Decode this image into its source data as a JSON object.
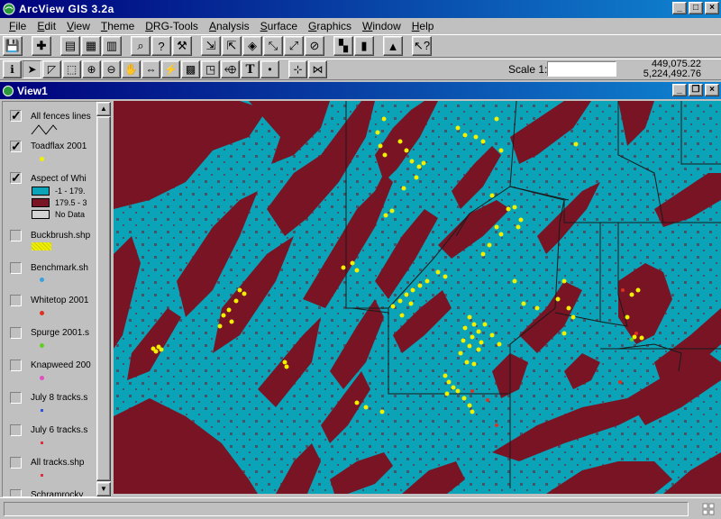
{
  "app": {
    "title": "ArcView GIS 3.2a"
  },
  "menu": [
    "File",
    "Edit",
    "View",
    "Theme",
    "DRG-Tools",
    "Analysis",
    "Surface",
    "Graphics",
    "Window",
    "Help"
  ],
  "scale": {
    "label": "Scale 1:",
    "value": ""
  },
  "coordinates": {
    "x": "449,075.22",
    "y": "5,224,492.76"
  },
  "view": {
    "title": "View1"
  },
  "status": {
    "text": ""
  },
  "colors": {
    "map_water": "#0aa3b8",
    "map_aspect_high": "#781424",
    "points": "#f0f000",
    "titlebar": "#00007b"
  },
  "toc": {
    "layers": [
      {
        "name": "All fences lines",
        "checked": true,
        "symbol": "line"
      },
      {
        "name": "Toadflax 2001",
        "checked": true,
        "symbol": "dot",
        "color": "#f0f000"
      },
      {
        "name": "Aspect of Whi",
        "checked": true,
        "symbol": "legend",
        "legend": [
          {
            "label": "-1 - 179.",
            "color": "#0aa3b8"
          },
          {
            "label": "179.5 - 3",
            "color": "#781424"
          },
          {
            "label": "No Data",
            "color": "#d4d4d4"
          }
        ]
      },
      {
        "name": "Buckbrush.shp",
        "checked": false,
        "symbol": "pattern",
        "color": "#f0f000"
      },
      {
        "name": "Benchmark.sh",
        "checked": false,
        "symbol": "dot",
        "color": "#3aa0e0"
      },
      {
        "name": "Whitetop 2001",
        "checked": false,
        "symbol": "dot",
        "color": "#e03020"
      },
      {
        "name": "Spurge 2001.s",
        "checked": false,
        "symbol": "dot",
        "color": "#60d020"
      },
      {
        "name": "Knapweed 200",
        "checked": false,
        "symbol": "dot",
        "color": "#e050c0"
      },
      {
        "name": "July 8 tracks.s",
        "checked": false,
        "symbol": "tick",
        "color": "#3050e0"
      },
      {
        "name": "July 6 tracks.s",
        "checked": false,
        "symbol": "tick",
        "color": "#e03040"
      },
      {
        "name": "All tracks.shp",
        "checked": false,
        "symbol": "tick",
        "color": "#e03040"
      },
      {
        "name": "Schramrocky",
        "checked": false,
        "symbol": "none"
      }
    ]
  }
}
